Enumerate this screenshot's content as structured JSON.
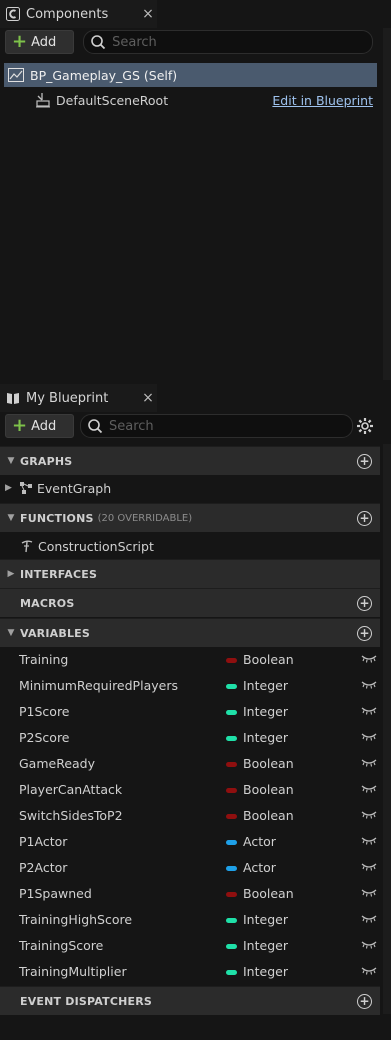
{
  "components": {
    "tab_title": "Components",
    "tab_close": "×",
    "add_label": "Add",
    "search_placeholder": "Search",
    "root_item": "BP_Gameplay_GS (Self)",
    "child_item": "DefaultSceneRoot",
    "edit_link": "Edit in Blueprint"
  },
  "my_blueprint": {
    "tab_title": "My Blueprint",
    "tab_close": "×",
    "add_label": "Add",
    "search_placeholder": "Search",
    "sections": {
      "graphs": "GRAPHS",
      "functions": "FUNCTIONS",
      "functions_sub": "(20 OVERRIDABLE)",
      "interfaces": "INTERFACES",
      "macros": "MACROS",
      "variables": "VARIABLES",
      "event_dispatchers": "EVENT DISPATCHERS"
    },
    "graph_items": [
      "EventGraph"
    ],
    "function_items": [
      "ConstructionScript"
    ],
    "variables": [
      {
        "name": "Training",
        "type": "Boolean"
      },
      {
        "name": "MinimumRequiredPlayers",
        "type": "Integer"
      },
      {
        "name": "P1Score",
        "type": "Integer"
      },
      {
        "name": "P2Score",
        "type": "Integer"
      },
      {
        "name": "GameReady",
        "type": "Boolean"
      },
      {
        "name": "PlayerCanAttack",
        "type": "Boolean"
      },
      {
        "name": "SwitchSidesToP2",
        "type": "Boolean"
      },
      {
        "name": "P1Actor",
        "type": "Actor"
      },
      {
        "name": "P2Actor",
        "type": "Actor"
      },
      {
        "name": "P1Spawned",
        "type": "Boolean"
      },
      {
        "name": "TrainingHighScore",
        "type": "Integer"
      },
      {
        "name": "TrainingScore",
        "type": "Integer"
      },
      {
        "name": "TrainingMultiplier",
        "type": "Integer"
      }
    ]
  },
  "type_colors": {
    "Boolean": "#8f0f0f",
    "Integer": "#1fe0a8",
    "Actor": "#1ea0e8"
  }
}
